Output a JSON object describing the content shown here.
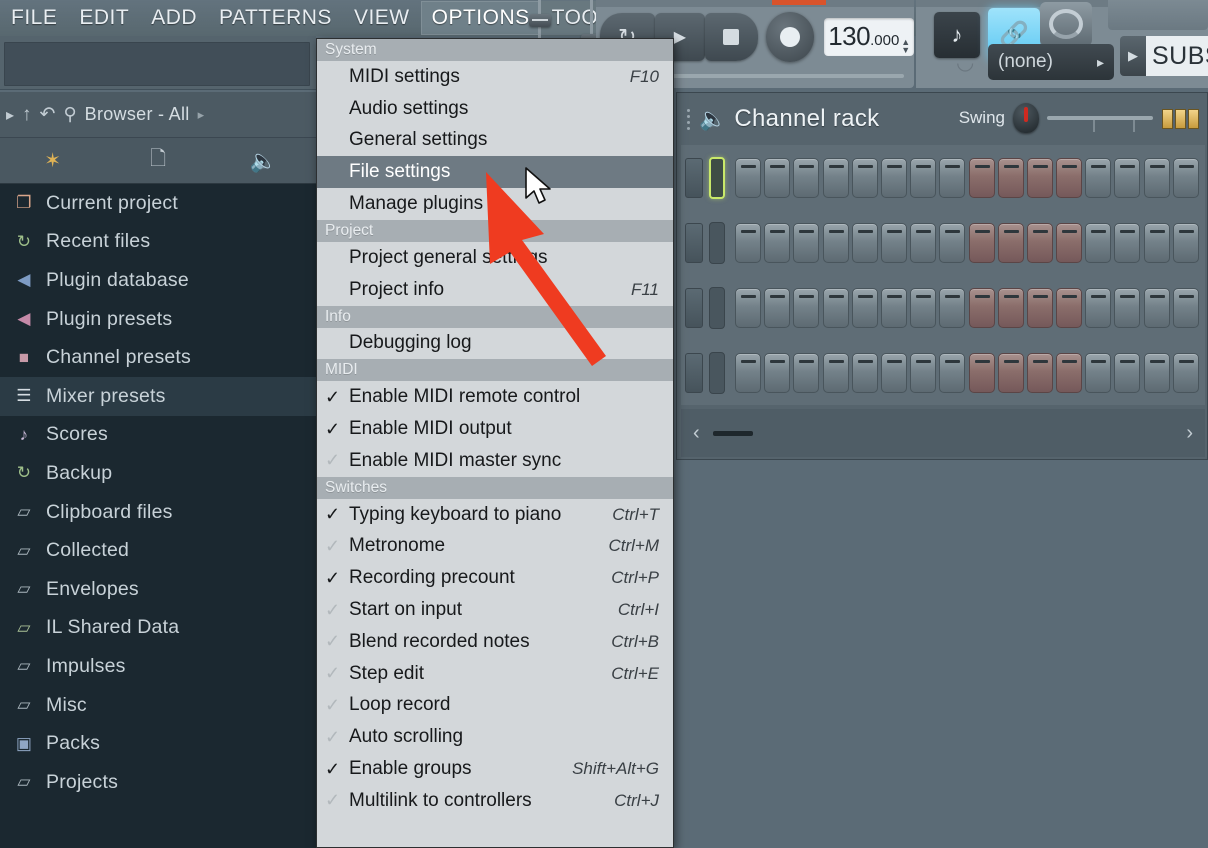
{
  "menubar": {
    "items": [
      {
        "label": "FILE",
        "state": "normal"
      },
      {
        "label": "EDIT",
        "state": "normal"
      },
      {
        "label": "ADD",
        "state": "normal"
      },
      {
        "label": "PATTERNS",
        "state": "normal"
      },
      {
        "label": "VIEW",
        "state": "normal"
      },
      {
        "label": "OPTIONS",
        "state": "active"
      },
      {
        "label": "TOOLS",
        "state": "tools"
      },
      {
        "label": "?",
        "state": "tools"
      }
    ]
  },
  "browser": {
    "nav": {
      "forward_icon": "play-right-icon",
      "up_icon": "arrow-up-icon",
      "back_icon": "undo-arrow-icon",
      "search_icon": "search-icon",
      "title": "Browser - All",
      "expand_icon": "chevron-right-icon"
    },
    "tools": [
      {
        "name": "sparkle-icon",
        "glyph": "✦"
      },
      {
        "name": "copy-pages-icon",
        "glyph": "❐"
      },
      {
        "name": "speaker-icon",
        "glyph": "◀"
      }
    ],
    "items": [
      {
        "label": "Current project",
        "icon": "document-pages-icon",
        "color": "#d9a58a",
        "selected": false
      },
      {
        "label": "Recent files",
        "icon": "folder-recent-icon",
        "color": "#9fc08a",
        "selected": false
      },
      {
        "label": "Plugin database",
        "icon": "speaker-blue-icon",
        "color": "#7e9cc4",
        "selected": false
      },
      {
        "label": "Plugin presets",
        "icon": "speaker-pink-icon",
        "color": "#c58aa8",
        "selected": false
      },
      {
        "label": "Channel presets",
        "icon": "channel-box-icon",
        "color": "#c79aa8",
        "selected": false
      },
      {
        "label": "Mixer presets",
        "icon": "mixer-faders-icon",
        "color": "#d6dde2",
        "selected": true
      },
      {
        "label": "Scores",
        "icon": "music-note-icon",
        "color": "#c8b9d6",
        "selected": false
      },
      {
        "label": "Backup",
        "icon": "folder-recent-icon",
        "color": "#9fc08a",
        "selected": false
      },
      {
        "label": "Clipboard files",
        "icon": "folder-icon",
        "color": "#aab6bd",
        "selected": false
      },
      {
        "label": "Collected",
        "icon": "folder-icon",
        "color": "#aab6bd",
        "selected": false
      },
      {
        "label": "Envelopes",
        "icon": "folder-icon",
        "color": "#aab6bd",
        "selected": false
      },
      {
        "label": "IL Shared Data",
        "icon": "folder-link-icon",
        "color": "#a9c096",
        "selected": false
      },
      {
        "label": "Impulses",
        "icon": "folder-icon",
        "color": "#aab6bd",
        "selected": false
      },
      {
        "label": "Misc",
        "icon": "folder-icon",
        "color": "#aab6bd",
        "selected": false
      },
      {
        "label": "Packs",
        "icon": "packs-box-icon",
        "color": "#8fa6c4",
        "selected": false
      },
      {
        "label": "Projects",
        "icon": "folder-link-icon",
        "color": "#aab6bd",
        "selected": false
      }
    ]
  },
  "transport": {
    "loop_icon": "loop-icon",
    "play_icon": "play-icon",
    "stop_icon": "stop-icon",
    "record_icon": "record-icon",
    "tempo_int": "130",
    "tempo_frac": ".000",
    "tempo_value": "130.000"
  },
  "topright": {
    "metronome_icon": "metronome-icon",
    "link_icon": "link-icon",
    "knob_icon": "knob-icon",
    "headphone_icon": "headphone-icon",
    "pattern_value": "(none)",
    "pattern_arrow_icon": "chevron-right-icon",
    "project_name": "SUBS",
    "project_arrow_icon": "play-right-icon"
  },
  "channel_rack": {
    "title": "Channel rack",
    "speaker_icon": "speaker-icon",
    "grip_icon": "grip-dots-icon",
    "swing_label": "Swing",
    "swing_knob_icon": "swing-knob-icon",
    "books_icon": "pattern-books-icon",
    "rows": 4,
    "steps_per_row": 16,
    "accent_groups": [
      2,
      4
    ],
    "active_led_row": 0,
    "footer": {
      "left_arrow_icon": "chevron-left-icon",
      "right_arrow_icon": "chevron-right-icon",
      "scrollbar": "horizontal-scrollbar"
    }
  },
  "dropdown": {
    "sections": [
      {
        "header": "System",
        "items": [
          {
            "label": "MIDI settings",
            "shortcut": "F10",
            "check": "none",
            "highlighted": false,
            "mnemonic": "M"
          },
          {
            "label": "Audio settings",
            "shortcut": "",
            "check": "none",
            "highlighted": false,
            "mnemonic": "A"
          },
          {
            "label": "General settings",
            "shortcut": "",
            "check": "none",
            "highlighted": false,
            "mnemonic": "G"
          },
          {
            "label": "File settings",
            "shortcut": "",
            "check": "none",
            "highlighted": true,
            "mnemonic": "F"
          },
          {
            "label": "Manage plugins",
            "shortcut": "",
            "check": "none",
            "highlighted": false,
            "mnemonic": "n"
          }
        ]
      },
      {
        "header": "Project",
        "items": [
          {
            "label": "Project general settings",
            "shortcut": "",
            "check": "none",
            "highlighted": false,
            "mnemonic": "P"
          },
          {
            "label": "Project info",
            "shortcut": "F11",
            "check": "none",
            "highlighted": false,
            "mnemonic": "P"
          }
        ]
      },
      {
        "header": "Info",
        "items": [
          {
            "label": "Debugging log",
            "shortcut": "",
            "check": "none",
            "highlighted": false,
            "mnemonic": "D"
          }
        ]
      },
      {
        "header": "MIDI",
        "items": [
          {
            "label": "Enable MIDI remote control",
            "shortcut": "",
            "check": "on",
            "highlighted": false
          },
          {
            "label": "Enable MIDI output",
            "shortcut": "",
            "check": "on",
            "highlighted": false
          },
          {
            "label": "Enable MIDI master sync",
            "shortcut": "",
            "check": "off",
            "highlighted": false
          }
        ]
      },
      {
        "header": "Switches",
        "items": [
          {
            "label": "Typing keyboard to piano",
            "shortcut": "Ctrl+T",
            "check": "on",
            "highlighted": false
          },
          {
            "label": "Metronome",
            "shortcut": "Ctrl+M",
            "check": "off",
            "highlighted": false
          },
          {
            "label": "Recording precount",
            "shortcut": "Ctrl+P",
            "check": "on",
            "highlighted": false
          },
          {
            "label": "Start on input",
            "shortcut": "Ctrl+I",
            "check": "off",
            "highlighted": false
          },
          {
            "label": "Blend recorded notes",
            "shortcut": "Ctrl+B",
            "check": "off",
            "highlighted": false
          },
          {
            "label": "Step edit",
            "shortcut": "Ctrl+E",
            "check": "off",
            "highlighted": false
          },
          {
            "label": "Loop record",
            "shortcut": "",
            "check": "off",
            "highlighted": false
          },
          {
            "label": "Auto scrolling",
            "shortcut": "",
            "check": "off",
            "highlighted": false
          },
          {
            "label": "Enable groups",
            "shortcut": "Shift+Alt+G",
            "check": "on",
            "highlighted": false,
            "mnemonic": "E"
          },
          {
            "label": "Multilink to controllers",
            "shortcut": "Ctrl+J",
            "check": "off",
            "highlighted": false
          }
        ]
      }
    ]
  },
  "annotation": {
    "arrow_color": "#ef3b20",
    "arrow_name": "red-pointer-arrow",
    "cursor_name": "mouse-cursor"
  },
  "colors": {
    "menu_bg": "#d3d7da",
    "menu_header": "#a7aeb3",
    "highlight": "#6e7a83",
    "browser_bg": "#1b2830",
    "chrome": "#7d8b94",
    "accent_blue": "#5cc8f2",
    "led_green": "#c9e96a"
  }
}
